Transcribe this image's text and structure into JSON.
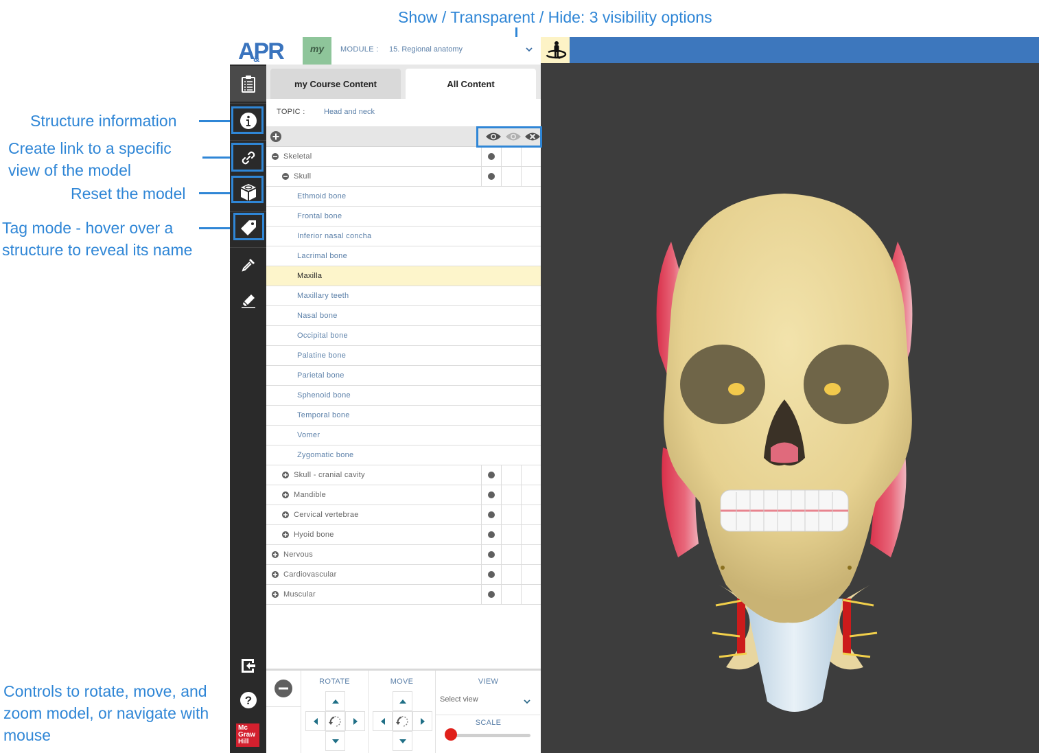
{
  "annotations": {
    "visibility": "Show / Transparent / Hide: 3 visibility options",
    "structure_info": "Structure information",
    "create_link_line1": "Create link to a specific",
    "create_link_line2": "view of the model",
    "reset": "Reset the model",
    "tag_line1": "Tag mode - hover over a",
    "tag_line2": "structure to reveal its name",
    "controls_line1": "Controls to rotate, move, and",
    "controls_line2": "zoom model, or navigate with",
    "controls_line3": "mouse",
    "color": "#2f86d6"
  },
  "header": {
    "logo_text": "APR",
    "logo_amp": "&",
    "my_badge": "my",
    "module_label": "MODULE  :",
    "module_value": "15. Regional anatomy",
    "topbar_color": "#3d77bd"
  },
  "sidebar": {
    "items": [
      {
        "name": "assignments",
        "icon": "clipboard-icon"
      },
      {
        "name": "structure-info",
        "icon": "info-icon"
      },
      {
        "name": "create-link",
        "icon": "link-icon"
      },
      {
        "name": "reset-model",
        "icon": "cube-icon"
      },
      {
        "name": "tag-mode",
        "icon": "tag-icon"
      },
      {
        "name": "dissect",
        "icon": "dropper-icon"
      },
      {
        "name": "draw",
        "icon": "highlighter-icon"
      }
    ],
    "bottom": [
      {
        "name": "exit",
        "icon": "exit-icon"
      },
      {
        "name": "help",
        "icon": "help-icon"
      }
    ],
    "brand": "Mc Graw Hill",
    "brand_lines": [
      "Mc",
      "Graw",
      "Hill"
    ]
  },
  "tabs": [
    {
      "label": "my Course Content",
      "active": false
    },
    {
      "label": "All Content",
      "active": true
    }
  ],
  "topic": {
    "label": "TOPIC  :",
    "value": "Head and neck"
  },
  "visibility_options": [
    "Show",
    "Transparent",
    "Hide"
  ],
  "tree": [
    {
      "label": "Skeletal",
      "level": 0,
      "toggle": "minus",
      "visibility": "show"
    },
    {
      "label": "Skull",
      "level": 1,
      "toggle": "minus",
      "visibility": "show"
    },
    {
      "label": "Ethmoid bone",
      "level": 2,
      "leaf": true
    },
    {
      "label": "Frontal bone",
      "level": 2,
      "leaf": true
    },
    {
      "label": "Inferior nasal concha",
      "level": 2,
      "leaf": true
    },
    {
      "label": "Lacrimal bone",
      "level": 2,
      "leaf": true
    },
    {
      "label": "Maxilla",
      "level": 2,
      "leaf": true,
      "selected": true
    },
    {
      "label": "Maxillary teeth",
      "level": 2,
      "leaf": true
    },
    {
      "label": "Nasal bone",
      "level": 2,
      "leaf": true
    },
    {
      "label": "Occipital bone",
      "level": 2,
      "leaf": true
    },
    {
      "label": "Palatine bone",
      "level": 2,
      "leaf": true
    },
    {
      "label": "Parietal bone",
      "level": 2,
      "leaf": true
    },
    {
      "label": "Sphenoid bone",
      "level": 2,
      "leaf": true
    },
    {
      "label": "Temporal bone",
      "level": 2,
      "leaf": true
    },
    {
      "label": "Vomer",
      "level": 2,
      "leaf": true
    },
    {
      "label": "Zygomatic bone",
      "level": 2,
      "leaf": true
    },
    {
      "label": "Skull - cranial cavity",
      "level": 1,
      "toggle": "plus",
      "visibility": "show"
    },
    {
      "label": "Mandible",
      "level": 1,
      "toggle": "plus",
      "visibility": "show"
    },
    {
      "label": "Cervical vertebrae",
      "level": 1,
      "toggle": "plus",
      "visibility": "show"
    },
    {
      "label": "Hyoid bone",
      "level": 1,
      "toggle": "plus",
      "visibility": "show"
    },
    {
      "label": "Nervous",
      "level": 0,
      "toggle": "plus",
      "visibility": "show"
    },
    {
      "label": "Cardiovascular",
      "level": 0,
      "toggle": "plus",
      "visibility": "show"
    },
    {
      "label": "Muscular",
      "level": 0,
      "toggle": "plus",
      "visibility": "show"
    }
  ],
  "controls": {
    "rotate_label": "ROTATE",
    "move_label": "MOVE",
    "view_label": "VIEW",
    "select_view": "Select view",
    "scale_label": "SCALE",
    "scale_value": 0
  }
}
